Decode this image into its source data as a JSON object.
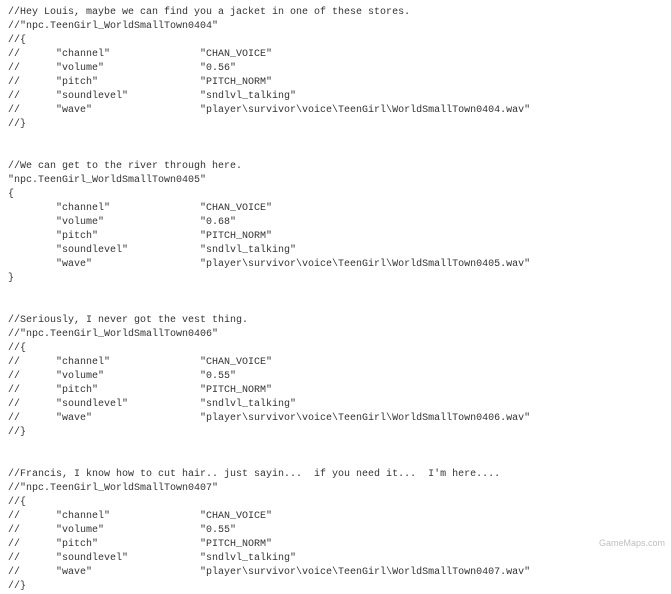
{
  "blocks": [
    {
      "comment": "//Hey Louis, maybe we can find you a jacket in one of these stores.",
      "id": "//\"npc.TeenGirl_WorldSmallTown0404\"",
      "open": "//{",
      "rows": [
        {
          "prefix": "//      ",
          "key": "\"channel\"",
          "value": "\"CHAN_VOICE\""
        },
        {
          "prefix": "//      ",
          "key": "\"volume\"",
          "value": "\"0.56\""
        },
        {
          "prefix": "//      ",
          "key": "\"pitch\"",
          "value": "\"PITCH_NORM\""
        },
        {
          "prefix": "//      ",
          "key": "\"soundlevel\"",
          "value": "\"sndlvl_talking\""
        },
        {
          "prefix": "//      ",
          "key": "\"wave\"",
          "value": "\"player\\survivor\\voice\\TeenGirl\\WorldSmallTown0404.wav\""
        }
      ],
      "close": "//}"
    },
    {
      "comment": "//We can get to the river through here.",
      "id": "\"npc.TeenGirl_WorldSmallTown0405\"",
      "open": "{",
      "rows": [
        {
          "prefix": "        ",
          "key": "\"channel\"",
          "value": "\"CHAN_VOICE\""
        },
        {
          "prefix": "        ",
          "key": "\"volume\"",
          "value": "\"0.68\""
        },
        {
          "prefix": "        ",
          "key": "\"pitch\"",
          "value": "\"PITCH_NORM\""
        },
        {
          "prefix": "        ",
          "key": "\"soundlevel\"",
          "value": "\"sndlvl_talking\""
        },
        {
          "prefix": "        ",
          "key": "\"wave\"",
          "value": "\"player\\survivor\\voice\\TeenGirl\\WorldSmallTown0405.wav\""
        }
      ],
      "close": "}"
    },
    {
      "comment": "//Seriously, I never got the vest thing.",
      "id": "//\"npc.TeenGirl_WorldSmallTown0406\"",
      "open": "//{",
      "rows": [
        {
          "prefix": "//      ",
          "key": "\"channel\"",
          "value": "\"CHAN_VOICE\""
        },
        {
          "prefix": "//      ",
          "key": "\"volume\"",
          "value": "\"0.55\""
        },
        {
          "prefix": "//      ",
          "key": "\"pitch\"",
          "value": "\"PITCH_NORM\""
        },
        {
          "prefix": "//      ",
          "key": "\"soundlevel\"",
          "value": "\"sndlvl_talking\""
        },
        {
          "prefix": "//      ",
          "key": "\"wave\"",
          "value": "\"player\\survivor\\voice\\TeenGirl\\WorldSmallTown0406.wav\""
        }
      ],
      "close": "//}"
    },
    {
      "comment": "//Francis, I know how to cut hair.. just sayin...  if you need it...  I'm here....",
      "id": "//\"npc.TeenGirl_WorldSmallTown0407\"",
      "open": "//{",
      "rows": [
        {
          "prefix": "//      ",
          "key": "\"channel\"",
          "value": "\"CHAN_VOICE\""
        },
        {
          "prefix": "//      ",
          "key": "\"volume\"",
          "value": "\"0.55\""
        },
        {
          "prefix": "//      ",
          "key": "\"pitch\"",
          "value": "\"PITCH_NORM\""
        },
        {
          "prefix": "//      ",
          "key": "\"soundlevel\"",
          "value": "\"sndlvl_talking\""
        },
        {
          "prefix": "//      ",
          "key": "\"wave\"",
          "value": "\"player\\survivor\\voice\\TeenGirl\\WorldSmallTown0407.wav\""
        }
      ],
      "close": "//}"
    }
  ],
  "watermark": "GameMaps.com"
}
